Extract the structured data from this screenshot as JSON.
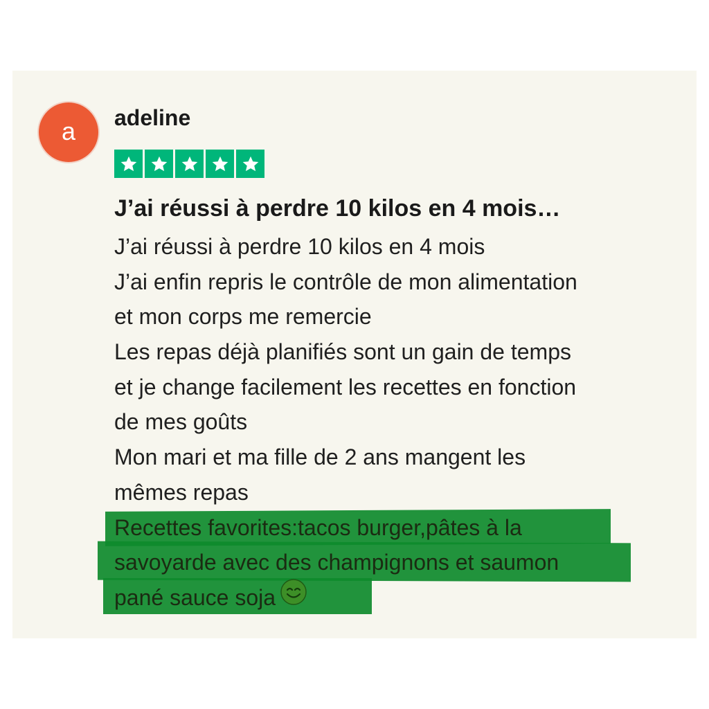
{
  "review": {
    "avatar_letter": "a",
    "username": "adeline",
    "rating": 5,
    "star_color": "#00b67a",
    "avatar_color": "#ec5a34",
    "highlight_color": "#0e8a2c",
    "title": "J’ai réussi à perdre 10 kilos en 4 mois…",
    "body_lines": [
      "J’ai réussi à perdre 10 kilos en 4 mois",
      "J’ai enfin repris le contrôle de mon alimentation",
      "et mon corps me remercie",
      "Les repas déjà planifiés sont un gain de temps",
      "et je change facilement les recettes en fonction",
      "de mes goûts",
      "Mon mari et ma fille de 2 ans mangent les",
      "mêmes repas"
    ],
    "highlighted_lines": [
      "Recettes favorites:tacos burger,pâtes à la",
      "savoyarde avec des champignons et saumon",
      "pané sauce soja"
    ],
    "emoji": "smiling-face-icon"
  }
}
